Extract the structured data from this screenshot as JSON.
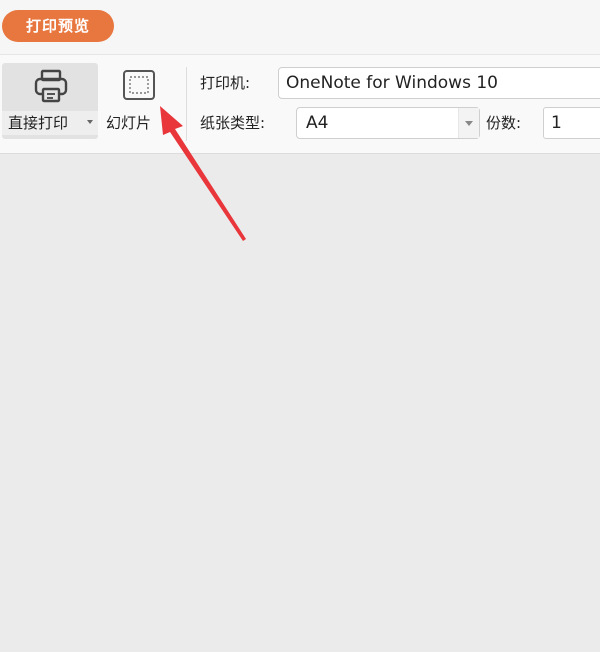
{
  "topbar": {
    "preview_label": "打印预览"
  },
  "toolbar": {
    "direct_print_label": "直接打印",
    "slide_label": "幻灯片",
    "printer_label": "打印机:",
    "printer_value": "OneNote for Windows 10",
    "paper_label": "纸张类型:",
    "paper_value": "A4",
    "copies_label": "份数:",
    "copies_value": "1"
  },
  "colors": {
    "accent": "#e8763f",
    "arrow": "#e8363a"
  },
  "icons": [
    "printer-icon",
    "slide-frame-icon",
    "chevron-down-icon",
    "arrow-annotation"
  ]
}
